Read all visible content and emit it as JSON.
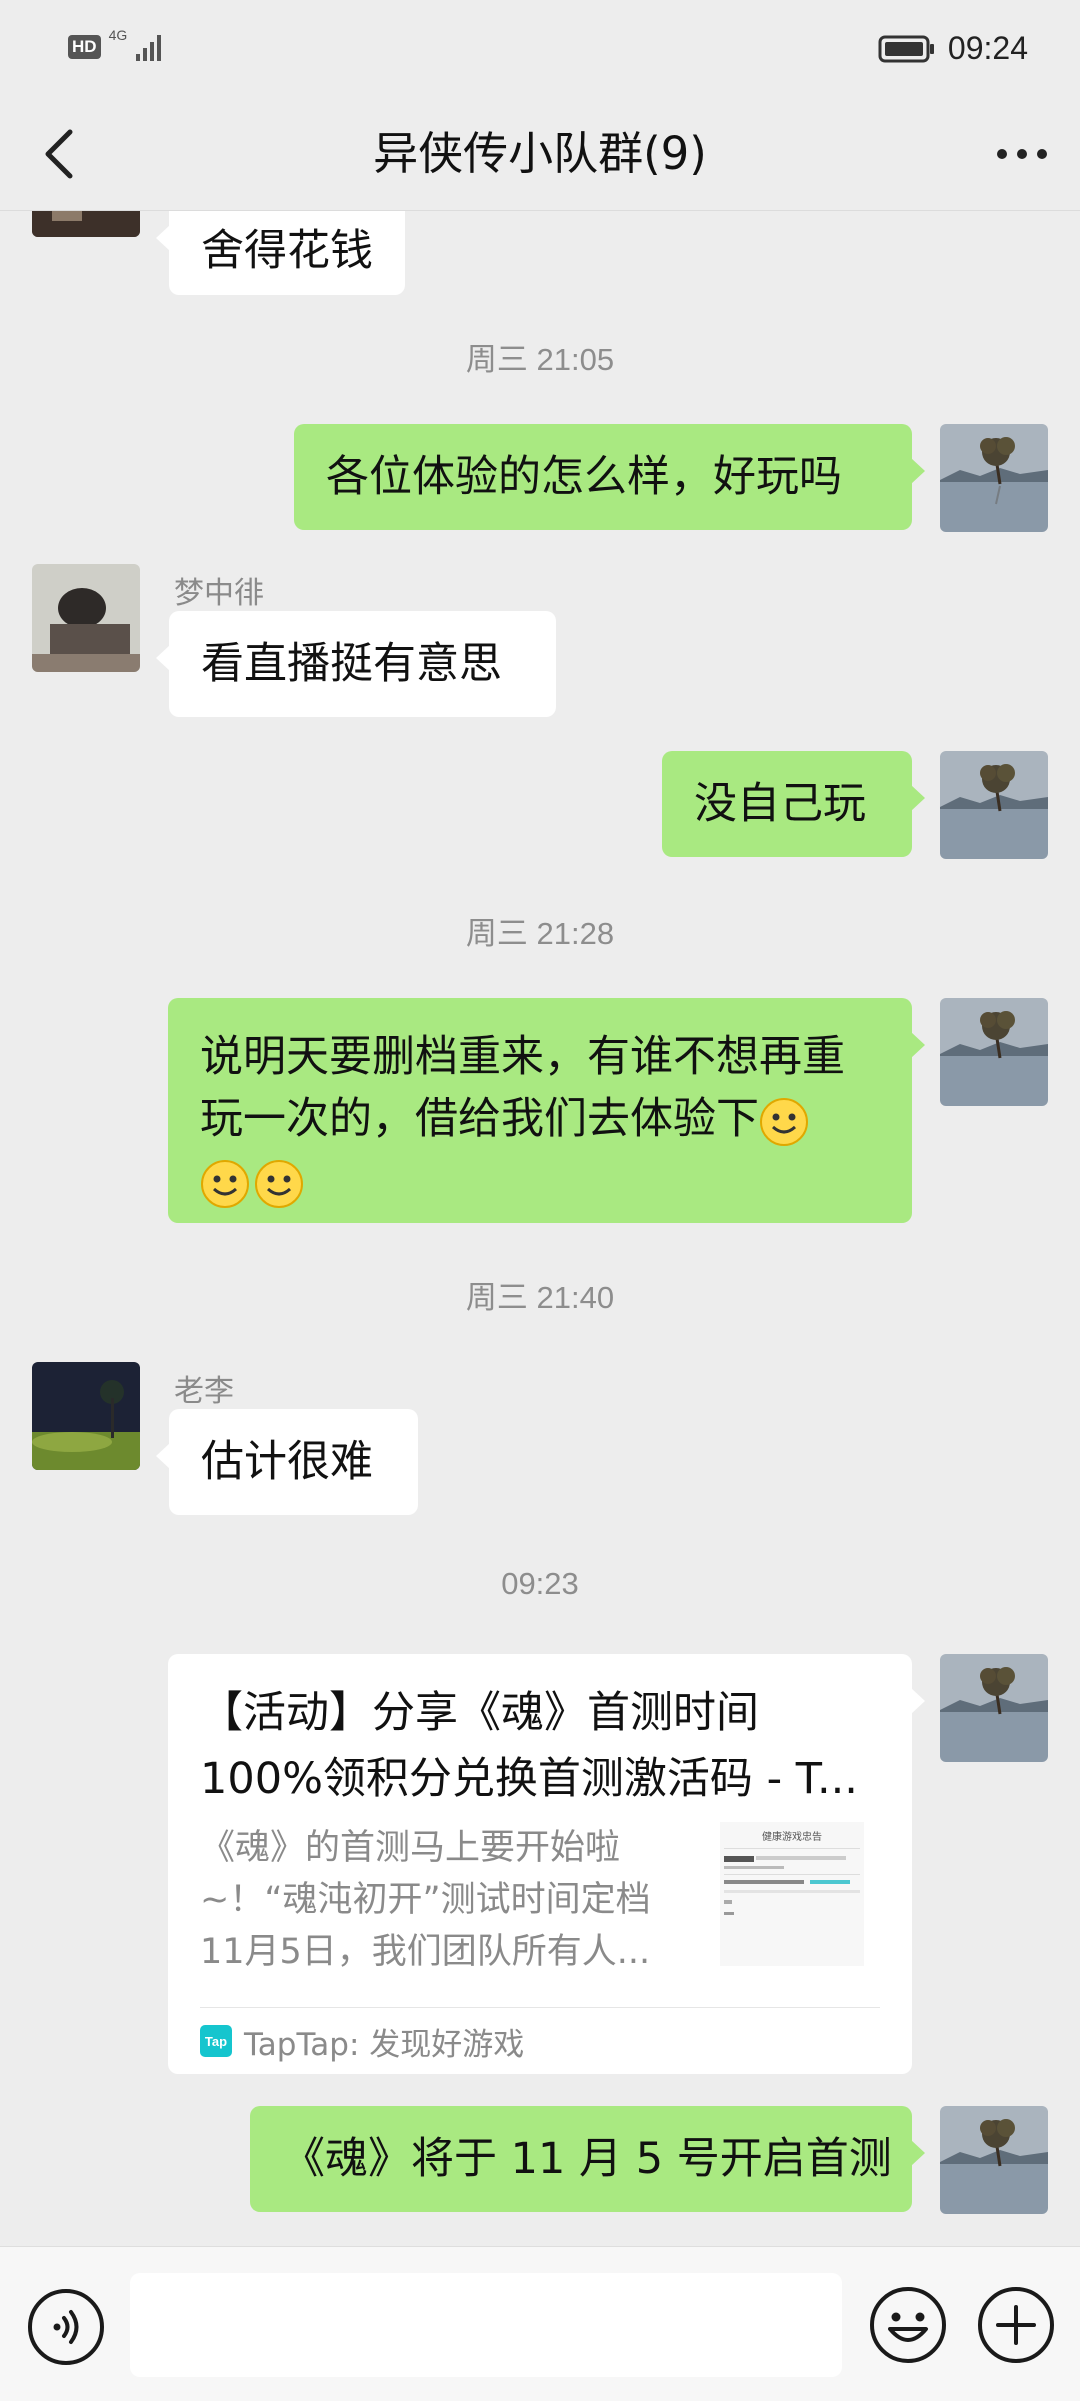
{
  "status_bar": {
    "hd": "HD",
    "network": "4G",
    "time": "09:24"
  },
  "header": {
    "title": "异侠传小队群(9)"
  },
  "chat": {
    "partial_message": "舍得花钱",
    "timestamps": [
      "周三 21:05",
      "周三 21:28",
      "周三 21:40",
      "09:23"
    ],
    "messages": [
      {
        "text": "各位体验的怎么样，好玩吗"
      },
      {
        "sender": "梦中徘",
        "text": "看直播挺有意思"
      },
      {
        "text": "没自己玩"
      },
      {
        "line1": "说明天要删档重来，有谁不想再重",
        "line2": "玩一次的，借给我们去体验下"
      },
      {
        "sender": "老李",
        "text": "估计很难"
      },
      {
        "text": "《魂》将于 11 月 5 号开启首测"
      }
    ],
    "link_card": {
      "title_line1": "【活动】分享《魂》首测时间",
      "title_line2": "100%领积分兑换首测激活码 - T...",
      "desc_line1": "《魂》的首测马上要开始啦",
      "desc_line2": "~！“魂沌初开”测试时间定档",
      "desc_line3": "11月5日，我们团队所有人...",
      "thumb_text": "健康游戏忠告",
      "source_logo": "Tap",
      "source": "TapTap: 发现好游戏"
    }
  },
  "icons": {
    "back": "back-arrow-icon",
    "more": "more-icon",
    "voice": "voice-icon",
    "emoji": "emoji-icon",
    "plus": "plus-icon",
    "battery": "battery-icon",
    "signal": "signal-icon"
  },
  "colors": {
    "background": "#ededed",
    "outgoing_bubble": "#a9e981",
    "incoming_bubble": "#ffffff"
  }
}
